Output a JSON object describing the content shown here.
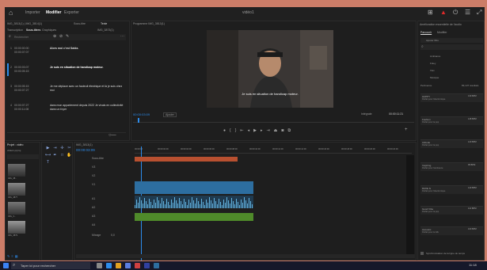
{
  "appbar": {
    "tabs": [
      "Importer",
      "Modifier",
      "Exporter"
    ],
    "active_tab": "Modifier",
    "title": "vidéo1"
  },
  "transcript_panel": {
    "tabs": [
      "Transcription",
      "Sous-titres",
      "Graphiques"
    ],
    "active_tab": "Sous-titres",
    "header_left": "IMG_3813(1) | IMG_3814(1)",
    "header_mid": "Sous-titre",
    "header_tab": "Texte",
    "header_right": "IMG_3873(1)",
    "search_placeholder": "Rechercher",
    "rows": [
      {
        "num": "1",
        "tc_in": "00:00:00:00",
        "tc_out": "00:00:07:07",
        "text": "Alors moi c'est Salda."
      },
      {
        "num": "2",
        "tc_in": "00:00:03:07",
        "tc_out": "00:00:05:15",
        "text": "Je suis en situation de handicap moteur."
      },
      {
        "num": "3",
        "tc_in": "00:00:05:15",
        "tc_out": "00:00:07:27",
        "text": "Je me déplace avec un fauteuil électrique et là je suis chez moi"
      },
      {
        "num": "4",
        "tc_in": "00:00:07:27",
        "tc_out": "00:00:11:08",
        "text": "dans mon appartement depuis 2022 Je vivais en collectivité dans un foyer"
      }
    ]
  },
  "program_monitor": {
    "title": "Programme IMG_3813(1)",
    "subtitle": "Je suis en situation de handicap moteur.",
    "timecode_left": "00:00:03:09",
    "fit": "Ajuster",
    "quality": "Intégrale",
    "timecode_right": "00:00:11:21"
  },
  "project_panel": {
    "title": "Projet : vidéo",
    "subtitle": "vidéo1.prproj",
    "items": [
      "IMG_38...",
      "IMG_3877",
      "IMG_3...",
      "IMG_3879",
      "IMG_38...",
      "IMG_3881"
    ]
  },
  "timeline": {
    "title": "IMG_3813(1)",
    "timecode": "00:00:03:09",
    "subtitle_track": "Sous-titre",
    "ruler": [
      "00:00:00",
      "00:00:02:00",
      "00:00:04:00",
      "00:00:06:00",
      "00:00:08:00",
      "00:00:10:00",
      "00:00:12:00",
      "00:00:14:00",
      "00:00:16:00",
      "00:00:18:00",
      "00:00:20:00",
      "00:00:22:00"
    ],
    "video_tracks": [
      "V3",
      "V2",
      "V1"
    ],
    "audio_tracks": [
      "A1",
      "A2",
      "A3",
      "A4"
    ],
    "mix_label": "Mixage",
    "mix_value": "0,0"
  },
  "essential_sound": {
    "title": "Amélioration essentielle de l'audio",
    "tabs": [
      "Parcourir",
      "Modifier"
    ],
    "search_placeholder": "Ajouter filtre",
    "categories": [
      "Ambiance",
      "Foley",
      "Voix",
      "Musique"
    ],
    "filter_label": "Pertinence",
    "filter_right": "83,137 résultats",
    "effects": [
      {
        "name": "HAPPY",
        "sub": "Parfait pour l'électronique",
        "dur": "1:56",
        "bpm": "130 BPM"
      },
      {
        "name": "Fashion",
        "sub": "Parfait pour la pop",
        "dur": "1:51",
        "bpm": "128 BPM"
      },
      {
        "name": "Attitude",
        "sub": "Parfait pour la pop",
        "dur": "1:40",
        "bpm": "120 BPM"
      },
      {
        "name": "Inspiring",
        "sub": "Parfait pour l'ambiance",
        "dur": "2:08",
        "bpm": "95 BPM"
      },
      {
        "name": "RAVE N",
        "sub": "Parfait pour l'électronique",
        "dur": "2:11",
        "bpm": "140 BPM"
      },
      {
        "name": "Good Vibe",
        "sub": "Parfait pour la pop",
        "dur": "1:45",
        "bpm": "110 BPM"
      },
      {
        "name": "Acoustic",
        "sub": "Parfait pour le folk",
        "dur": "2:02",
        "bpm": "100 BPM"
      }
    ],
    "footer": "Synchronisation de la ligne de temps"
  },
  "taskbar": {
    "search_placeholder": "Taper ici pour rechercher",
    "time": "11:18"
  },
  "colors": {
    "accent": "#2d8ceb",
    "audio": "#4f8a2a",
    "video": "#2d6ea0",
    "title_clip": "#b85030"
  }
}
